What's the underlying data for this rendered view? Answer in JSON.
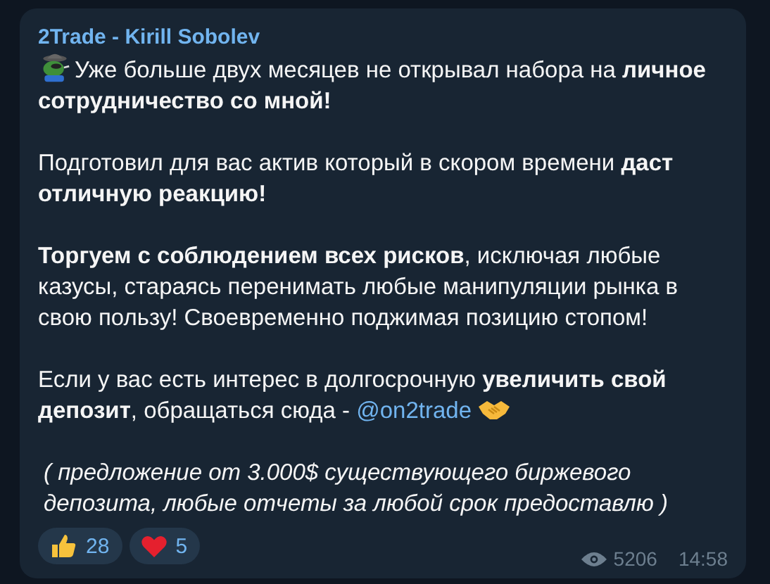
{
  "message": {
    "author": "2Trade - Kirill Sobolev",
    "paragraphs": [
      {
        "kind": "emoji-lead",
        "text": "Уже больше двух месяцев не открывал набора на **личное сотрудничество со мной!**"
      },
      {
        "kind": "plain",
        "text": "Подготовил для вас актив который в скором времени **даст отличную реакцию!**"
      },
      {
        "kind": "plain",
        "text": "**Торгуем с соблюдением всех рисков**, исключая любые казусы, стараясь перенимать любые манипуляции рынка в свою пользу! Своевременно поджимая позицию стопом!"
      },
      {
        "kind": "link",
        "text": "Если у вас есть интерес в долгосрочную **увеличить свой депозит**, обращаться сюда -",
        "link": "@on2trade"
      },
      {
        "kind": "italic",
        "text": "( предложение от 3.000$ существующего биржевого депозита, любые отчеты за любой срок предоставлю )"
      }
    ],
    "reactions": [
      {
        "kind": "thumbs-up",
        "count": "28"
      },
      {
        "kind": "heart",
        "count": "5"
      }
    ],
    "views": "5206",
    "time": "14:58"
  }
}
